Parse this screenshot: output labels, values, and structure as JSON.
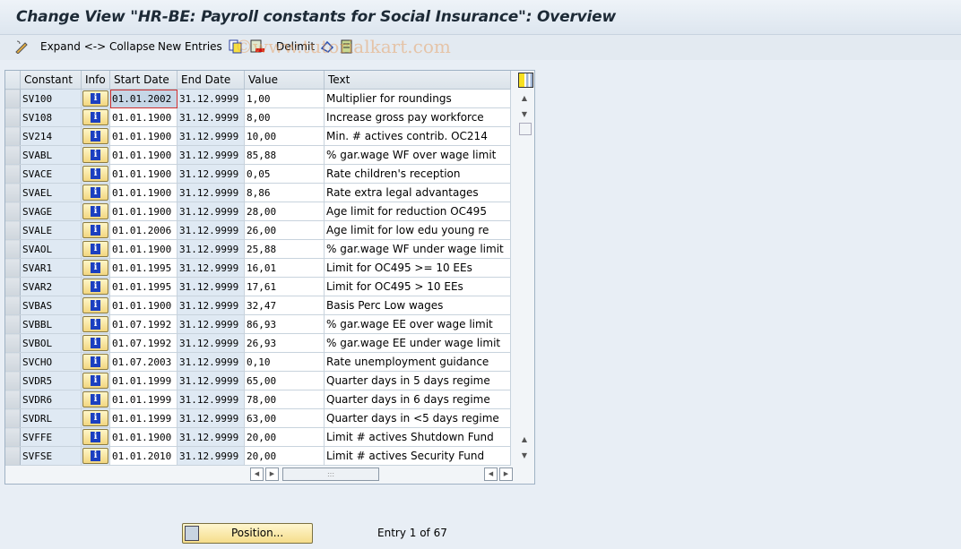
{
  "title": "Change View \"HR-BE: Payroll constants for Social Insurance\": Overview",
  "toolbar": {
    "expand_collapse": "Expand <-> Collapse",
    "new_entries": "New Entries",
    "delimit": "Delimit",
    "watermark": "©www.tutorialkart.com"
  },
  "table": {
    "headers": [
      "Constant",
      "Info",
      "Start Date",
      "End Date",
      "Value",
      "Text"
    ],
    "rows": [
      {
        "constant": "SV100",
        "start": "01.01.2002",
        "end": "31.12.9999",
        "value": "1,00",
        "text": "Multiplier for roundings"
      },
      {
        "constant": "SV108",
        "start": "01.01.1900",
        "end": "31.12.9999",
        "value": "8,00",
        "text": "Increase gross pay workforce"
      },
      {
        "constant": "SV214",
        "start": "01.01.1900",
        "end": "31.12.9999",
        "value": "10,00",
        "text": "Min. # actives contrib. OC214"
      },
      {
        "constant": "SVABL",
        "start": "01.01.1900",
        "end": "31.12.9999",
        "value": "85,88",
        "text": "% gar.wage WF over wage limit"
      },
      {
        "constant": "SVACE",
        "start": "01.01.1900",
        "end": "31.12.9999",
        "value": "0,05",
        "text": "Rate children's reception"
      },
      {
        "constant": "SVAEL",
        "start": "01.01.1900",
        "end": "31.12.9999",
        "value": "8,86",
        "text": "Rate extra legal advantages"
      },
      {
        "constant": "SVAGE",
        "start": "01.01.1900",
        "end": "31.12.9999",
        "value": "28,00",
        "text": "Age limit for reduction OC495"
      },
      {
        "constant": "SVALE",
        "start": "01.01.2006",
        "end": "31.12.9999",
        "value": "26,00",
        "text": "Age limit for low edu young re"
      },
      {
        "constant": "SVAOL",
        "start": "01.01.1900",
        "end": "31.12.9999",
        "value": "25,88",
        "text": "% gar.wage WF under wage limit"
      },
      {
        "constant": "SVAR1",
        "start": "01.01.1995",
        "end": "31.12.9999",
        "value": "16,01",
        "text": "Limit for  OC495 >= 10 EEs"
      },
      {
        "constant": "SVAR2",
        "start": "01.01.1995",
        "end": "31.12.9999",
        "value": "17,61",
        "text": "Limit for OC495 > 10 EEs"
      },
      {
        "constant": "SVBAS",
        "start": "01.01.1900",
        "end": "31.12.9999",
        "value": "32,47",
        "text": "Basis Perc Low wages"
      },
      {
        "constant": "SVBBL",
        "start": "01.07.1992",
        "end": "31.12.9999",
        "value": "86,93",
        "text": "% gar.wage EE over wage limit"
      },
      {
        "constant": "SVBOL",
        "start": "01.07.1992",
        "end": "31.12.9999",
        "value": "26,93",
        "text": "% gar.wage EE under wage limit"
      },
      {
        "constant": "SVCHO",
        "start": "01.07.2003",
        "end": "31.12.9999",
        "value": "0,10",
        "text": "Rate unemployment guidance"
      },
      {
        "constant": "SVDR5",
        "start": "01.01.1999",
        "end": "31.12.9999",
        "value": "65,00",
        "text": "Quarter days in 5 days regime"
      },
      {
        "constant": "SVDR6",
        "start": "01.01.1999",
        "end": "31.12.9999",
        "value": "78,00",
        "text": "Quarter days in 6 days regime"
      },
      {
        "constant": "SVDRL",
        "start": "01.01.1999",
        "end": "31.12.9999",
        "value": "63,00",
        "text": "Quarter days in <5 days regime"
      },
      {
        "constant": "SVFFE",
        "start": "01.01.1900",
        "end": "31.12.9999",
        "value": "20,00",
        "text": "Limit # actives Shutdown Fund"
      },
      {
        "constant": "SVFSE",
        "start": "01.01.2010",
        "end": "31.12.9999",
        "value": "20,00",
        "text": "Limit # actives Security Fund"
      }
    ]
  },
  "footer": {
    "position_label": "Position...",
    "entry_text": "Entry 1 of 67"
  }
}
